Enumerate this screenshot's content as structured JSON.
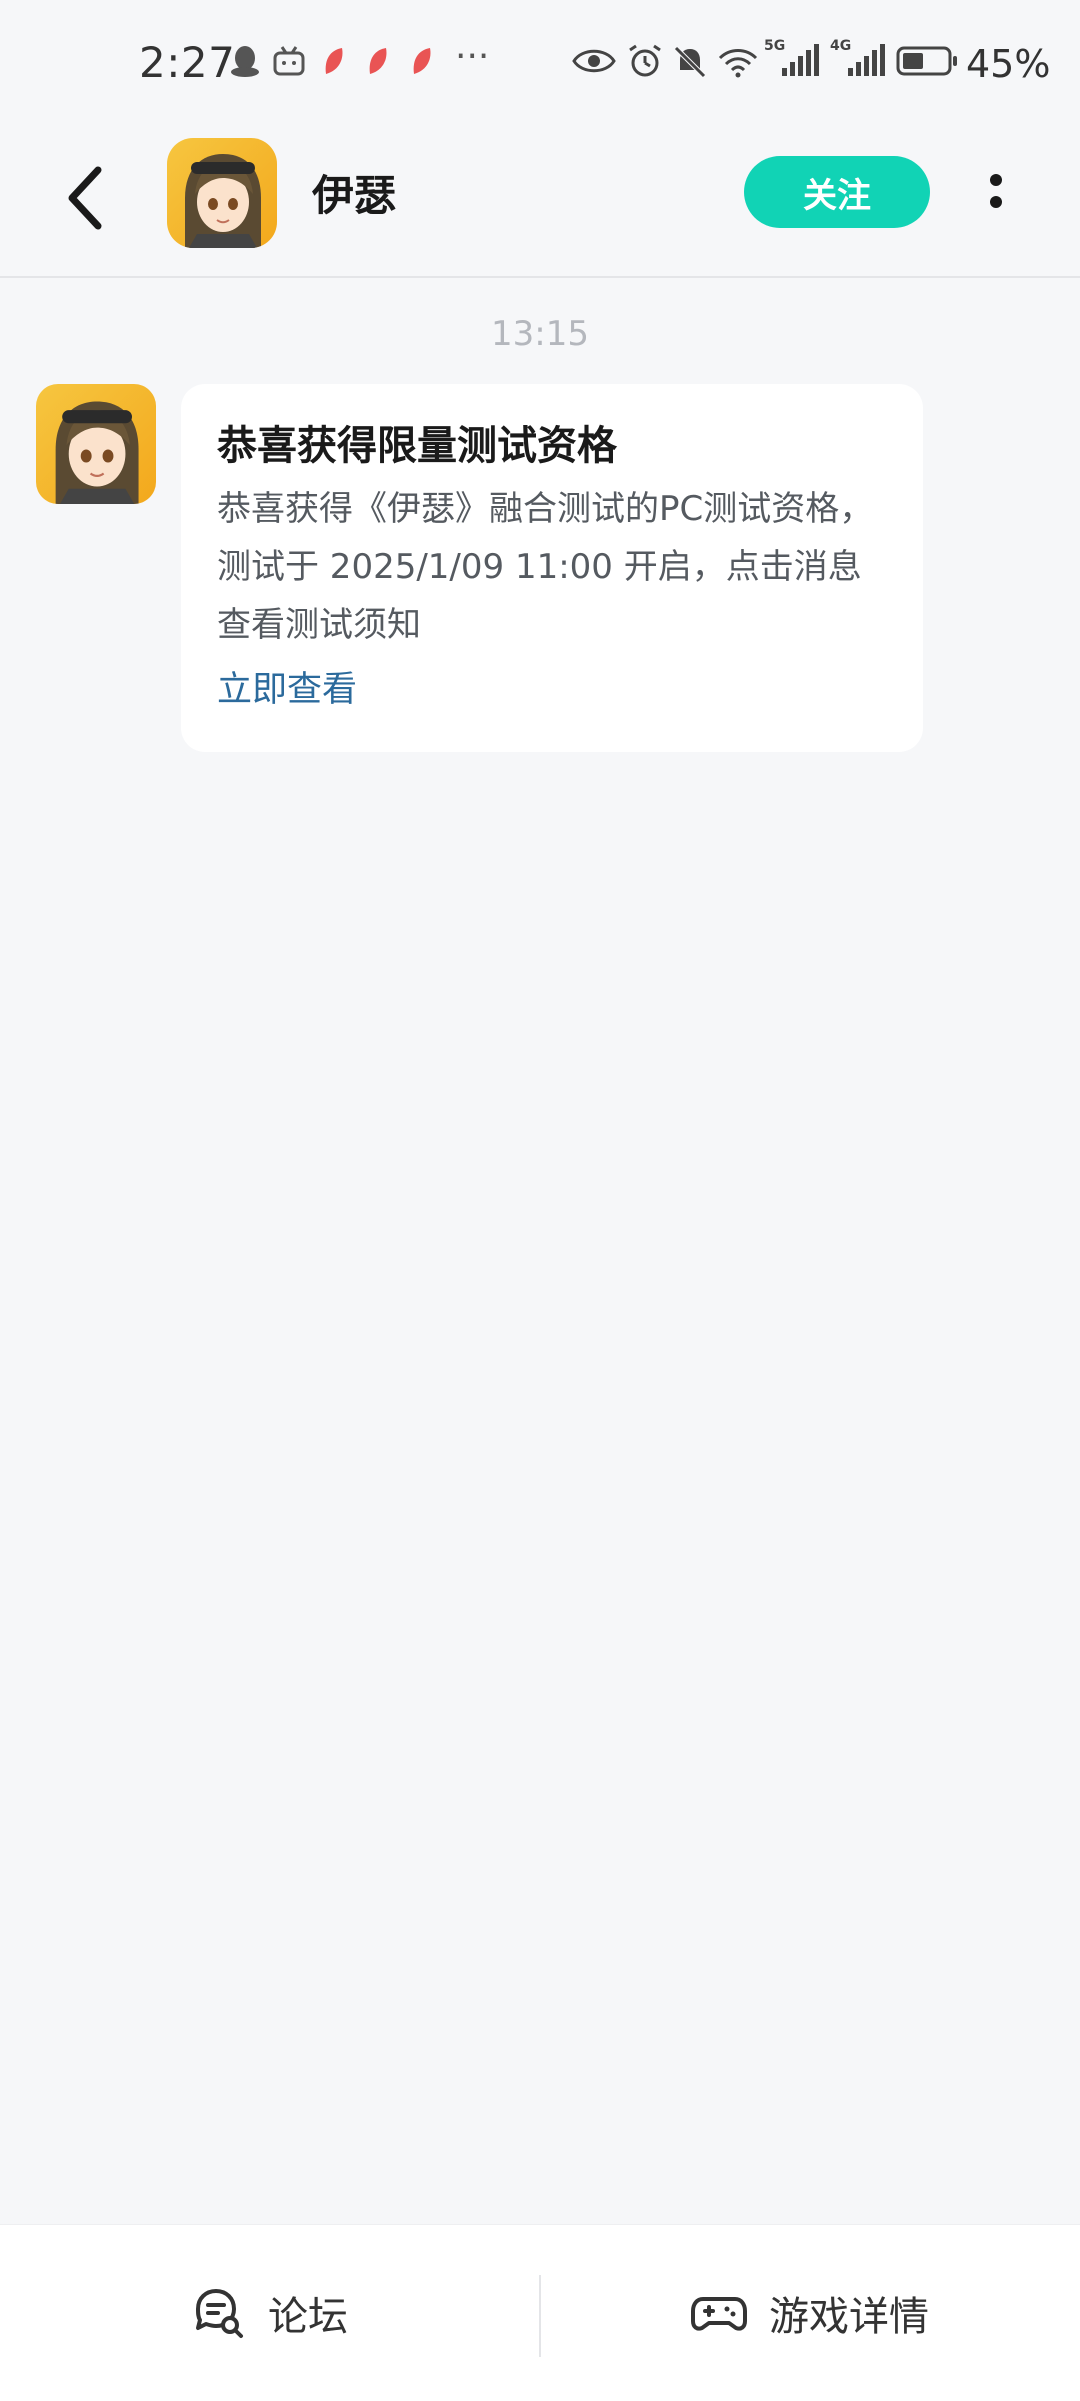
{
  "status_bar": {
    "time": "2:27",
    "battery_percent": "45%",
    "dots": "···",
    "network_labels": [
      "5G",
      "4G"
    ]
  },
  "header": {
    "title": "伊瑟",
    "follow_label": "关注"
  },
  "chat": {
    "time_divider": "13:15",
    "message": {
      "title": "恭喜获得限量测试资格",
      "body_lines": [
        "恭喜获得《伊瑟》融合测试的PC测试资格，",
        "测试于 2025/1/09 11:00 开启，点击消息",
        "查看测试须知"
      ],
      "link": "立即查看"
    }
  },
  "bottom_bar": {
    "tabs": [
      {
        "label": "论坛",
        "icon": "forum-chat-icon"
      },
      {
        "label": "游戏详情",
        "icon": "gamepad-icon"
      }
    ]
  },
  "colors": {
    "accent": "#11d3b5",
    "link": "#2b6a9c",
    "background": "#f6f7f9"
  }
}
